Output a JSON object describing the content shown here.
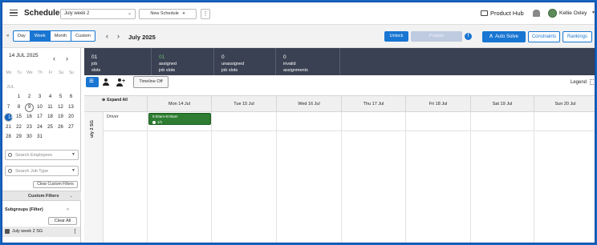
{
  "topbar": {
    "title": "Schedules",
    "schedule_select": "July week 2",
    "new_schedule": "New Schedule",
    "product_hub": "Product Hub",
    "user_name": "Kellie Oxley",
    "icons": [
      "menu-icon",
      "chevron-down-icon",
      "plus-icon",
      "kebab-icon",
      "product-hub-icon",
      "bell-icon",
      "avatar",
      "caret-down-icon"
    ]
  },
  "toolbar": {
    "view_tabs": [
      "Day",
      "Week",
      "Month",
      "Custom"
    ],
    "active_tab": "Week",
    "month_title": "July 2025",
    "unlock": "Unlock",
    "publish": "Publish",
    "autosolve": "Auto Solve",
    "constraints": "Constraints",
    "rankings": "Rankings",
    "accent": "#1976d2"
  },
  "calendar": {
    "selected_date": "14 JUL 2025",
    "weekdays": [
      "Mo",
      "Tu",
      "We",
      "Th",
      "Fr",
      "Sa",
      "Su"
    ],
    "month_label": "JUL",
    "days": [
      "1",
      "2",
      "3",
      "4",
      "5",
      "6",
      "7",
      "8",
      "9",
      "10",
      "11",
      "12",
      "13",
      "14",
      "15",
      "16",
      "17",
      "18",
      "19",
      "20",
      "21",
      "22",
      "23",
      "24",
      "25",
      "26",
      "27",
      "28",
      "29",
      "30",
      "31"
    ],
    "selected_day": "14",
    "today_day": "9",
    "first_weekday_offset": 1
  },
  "filters": {
    "search_employees": "Search Employees",
    "search_job_type": "Search Job Type",
    "clear_custom_filters": "Clear Custom Filters",
    "custom_filters": "Custom Filters",
    "subgroups": "Subgroups (Filter)",
    "clear_all": "Clear All",
    "subgroup_item": "July week 2 SG"
  },
  "stats": [
    {
      "value": "01",
      "line1": "job",
      "line2": "slots"
    },
    {
      "value": "01",
      "line1": "assigned",
      "line2": "job slots"
    },
    {
      "value": "0",
      "line1": "unassigned",
      "line2": "job slots"
    },
    {
      "value": "0",
      "line1": "invalid",
      "line2": "assignments"
    }
  ],
  "controls": {
    "timeline": "Timeline Off",
    "legend": "Legend"
  },
  "grid": {
    "expand_all": "Expand All",
    "days": [
      "Mon 14 Jul",
      "Tue 15 Jul",
      "Wed 16 Jul",
      "Thu 17 Jul",
      "Fri 18 Jul",
      "Sat 19 Jul",
      "Sun 20 Jul"
    ],
    "group_label": "uly 2 SG",
    "role": "Driver",
    "shift": {
      "time": "8:00am-8:00am",
      "count": "1/1",
      "color": "#2e7d32"
    }
  }
}
